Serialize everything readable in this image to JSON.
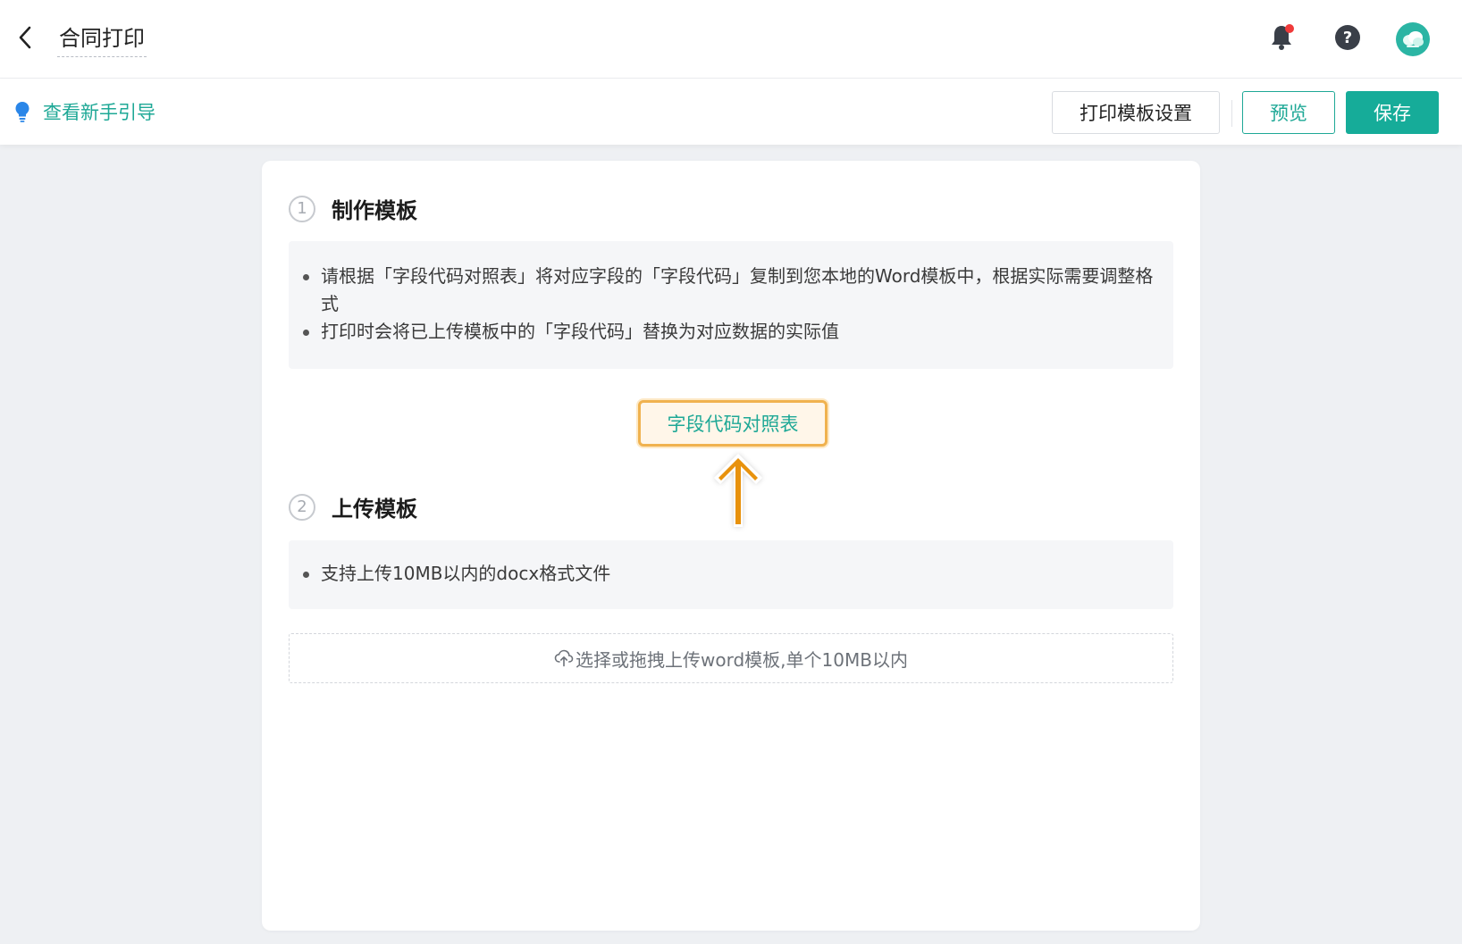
{
  "header": {
    "title": "合同打印",
    "icons": [
      "back-icon",
      "bell-icon",
      "help-icon",
      "avatar"
    ],
    "help_glyph": "?"
  },
  "toolbar": {
    "guide_label": "查看新手引导",
    "settings_label": "打印模板设置",
    "preview_label": "预览",
    "save_label": "保存"
  },
  "steps": [
    {
      "number": "1",
      "title": "制作模板",
      "notes": [
        "请根据「字段代码对照表」将对应字段的「字段代码」复制到您本地的Word模板中，根据实际需要调整格式",
        "打印时会将已上传模板中的「字段代码」替换为对应数据的实际值"
      ],
      "action_label": "字段代码对照表"
    },
    {
      "number": "2",
      "title": "上传模板",
      "notes": [
        "支持上传10MB以内的docx格式文件"
      ],
      "upload_label": "选择或拖拽上传word模板,单个10MB以内"
    }
  ],
  "colors": {
    "accent": "#16ac99",
    "highlight": "#f0b24f",
    "arrow": "#e8920f",
    "notification_dot": "#f03a3a"
  }
}
